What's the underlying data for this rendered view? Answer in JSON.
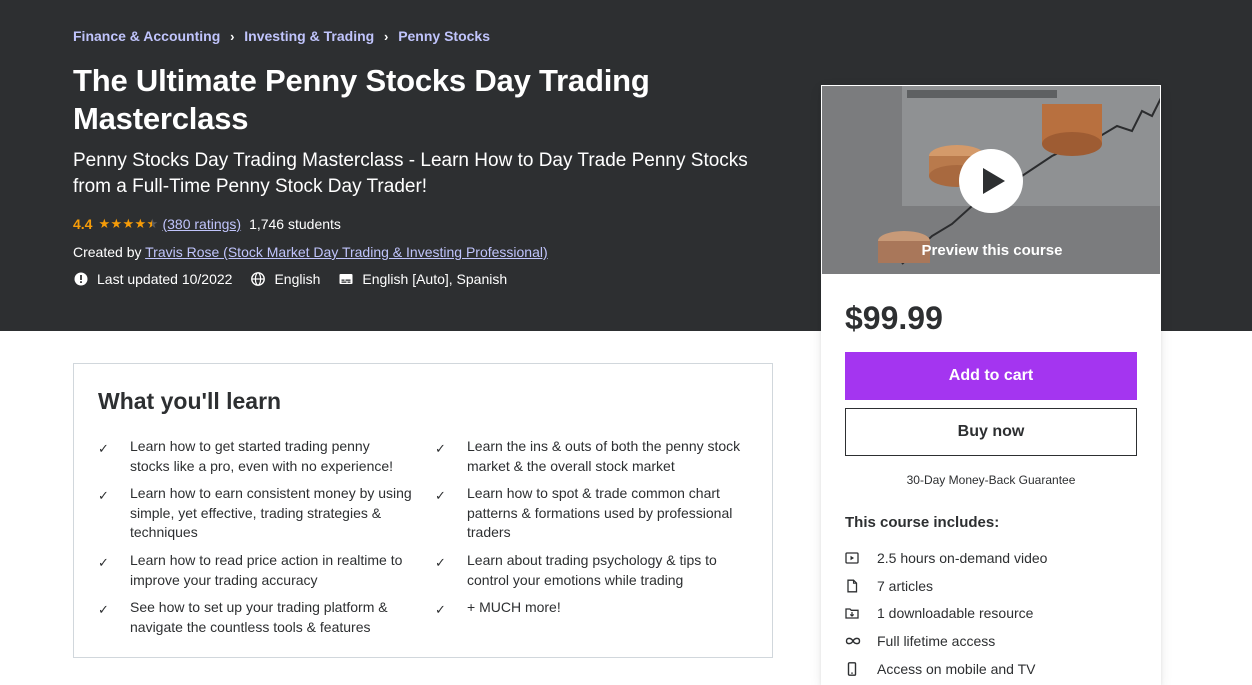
{
  "breadcrumb": [
    "Finance & Accounting",
    "Investing & Trading",
    "Penny Stocks"
  ],
  "course": {
    "title": "The Ultimate Penny Stocks Day Trading Masterclass",
    "subtitle": "Penny Stocks Day Trading Masterclass - Learn How to Day Trade Penny Stocks from a Full-Time Penny Stock Day Trader!",
    "rating": "4.4",
    "rating_value": 4.4,
    "ratings_link": "(380 ratings)",
    "students": "1,746 students",
    "created_by_label": "Created by",
    "instructor": "Travis Rose (Stock Market Day Trading & Investing Professional)",
    "last_updated": "Last updated 10/2022",
    "language": "English",
    "captions": "English [Auto], Spanish"
  },
  "learn": {
    "title": "What you'll learn",
    "items": [
      "Learn how to get started trading penny stocks like a pro, even with no experience!",
      "Learn the ins & outs of both the penny stock market & the overall stock market",
      "Learn how to earn consistent money by using simple, yet effective, trading strategies & techniques",
      "Learn how to spot & trade common chart patterns & formations used by professional traders",
      "Learn how to read price action in realtime to improve your trading accuracy",
      "Learn about trading psychology & tips to control your emotions while trading",
      "See how to set up your trading platform & navigate the countless tools & features",
      "+ MUCH more!"
    ]
  },
  "sidebar": {
    "preview_label": "Preview this course",
    "price": "$99.99",
    "add_to_cart": "Add to cart",
    "buy_now": "Buy now",
    "guarantee": "30-Day Money-Back Guarantee",
    "includes_title": "This course includes:",
    "includes": [
      {
        "icon": "video-icon",
        "label": "2.5 hours on-demand video"
      },
      {
        "icon": "article-icon",
        "label": "7 articles"
      },
      {
        "icon": "download-icon",
        "label": "1 downloadable resource"
      },
      {
        "icon": "infinity-icon",
        "label": "Full lifetime access"
      },
      {
        "icon": "mobile-icon",
        "label": "Access on mobile and TV"
      }
    ]
  },
  "colors": {
    "hero_bg": "#2d2f31",
    "link_purple": "#c0c4fc",
    "star_orange": "#f69c08",
    "cart_purple": "#a435f0"
  }
}
